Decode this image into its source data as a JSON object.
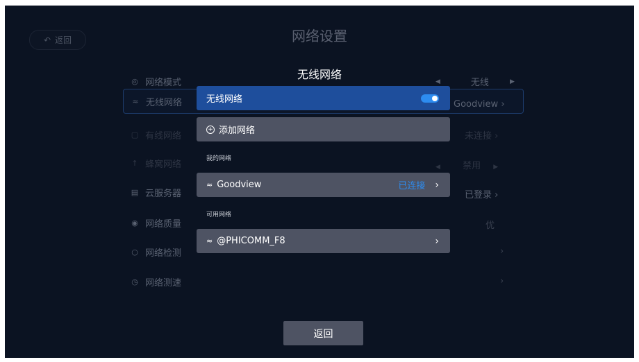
{
  "background": {
    "back_label": "返回",
    "title": "网络设置",
    "rows": [
      {
        "label": "网络模式",
        "value": "无线",
        "icon": "globe-icon"
      },
      {
        "label": "无线网络",
        "value": "Goodview",
        "icon": "wifi-icon"
      },
      {
        "label": "有线网络",
        "value": "未连接",
        "icon": "ethernet-icon"
      },
      {
        "label": "蜂窝网络",
        "value": "禁用",
        "icon": "cellular-icon"
      },
      {
        "label": "云服务器",
        "value": "已登录",
        "icon": "server-icon"
      },
      {
        "label": "网络质量",
        "value": "优",
        "icon": "quality-icon"
      },
      {
        "label": "网络检测",
        "value": "",
        "icon": "detect-icon"
      },
      {
        "label": "网络测速",
        "value": "",
        "icon": "speed-icon"
      }
    ]
  },
  "overlay": {
    "title": "无线网络",
    "wifi_toggle_label": "无线网络",
    "wifi_enabled": true,
    "add_network_label": "添加网络",
    "my_networks_label": "我的网络",
    "my_networks": [
      {
        "ssid": "Goodview",
        "status": "已连接"
      }
    ],
    "available_label": "可用网络",
    "available_networks": [
      {
        "ssid": "@PHICOMM_F8"
      }
    ],
    "return_label": "返回"
  },
  "colors": {
    "accent": "#2d8cf0",
    "selected_row": "#1e4e9c",
    "row_bg": "#4e5363",
    "screen_bg": "#0b1322"
  }
}
